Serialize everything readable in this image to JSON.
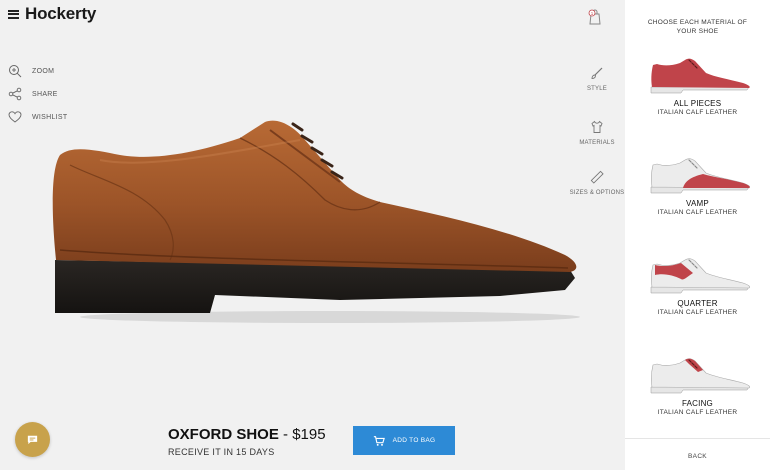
{
  "header": {
    "brand": "Hockerty",
    "bag_count": "1"
  },
  "left_tools": [
    {
      "label": "ZOOM",
      "icon": "zoom-icon"
    },
    {
      "label": "SHARE",
      "icon": "share-icon"
    },
    {
      "label": "WISHLIST",
      "icon": "heart-icon"
    }
  ],
  "right_tools": [
    {
      "label": "STYLE",
      "icon": "brush-icon"
    },
    {
      "label": "MATERIALS",
      "icon": "shirt-icon"
    },
    {
      "label": "SIZES & OPTIONS",
      "icon": "ruler-icon"
    }
  ],
  "product": {
    "name": "OXFORD SHOE",
    "price": "- $195",
    "delivery": "RECEIVE IT IN 15 DAYS",
    "add_label": "ADD TO BAG"
  },
  "panel": {
    "title_line1": "CHOOSE EACH MATERIAL OF",
    "title_line2": "YOUR SHOE",
    "options": [
      {
        "name": "ALL PIECES",
        "material": "ITALIAN CALF LEATHER"
      },
      {
        "name": "VAMP",
        "material": "ITALIAN CALF LEATHER"
      },
      {
        "name": "QUARTER",
        "material": "ITALIAN CALF LEATHER"
      },
      {
        "name": "FACING",
        "material": "ITALIAN CALF LEATHER"
      }
    ],
    "back_label": "BACK"
  },
  "colors": {
    "leather": "#a0582a",
    "highlight": "#c0444a",
    "button": "#2d8ad6",
    "chat": "#c8a24b"
  }
}
